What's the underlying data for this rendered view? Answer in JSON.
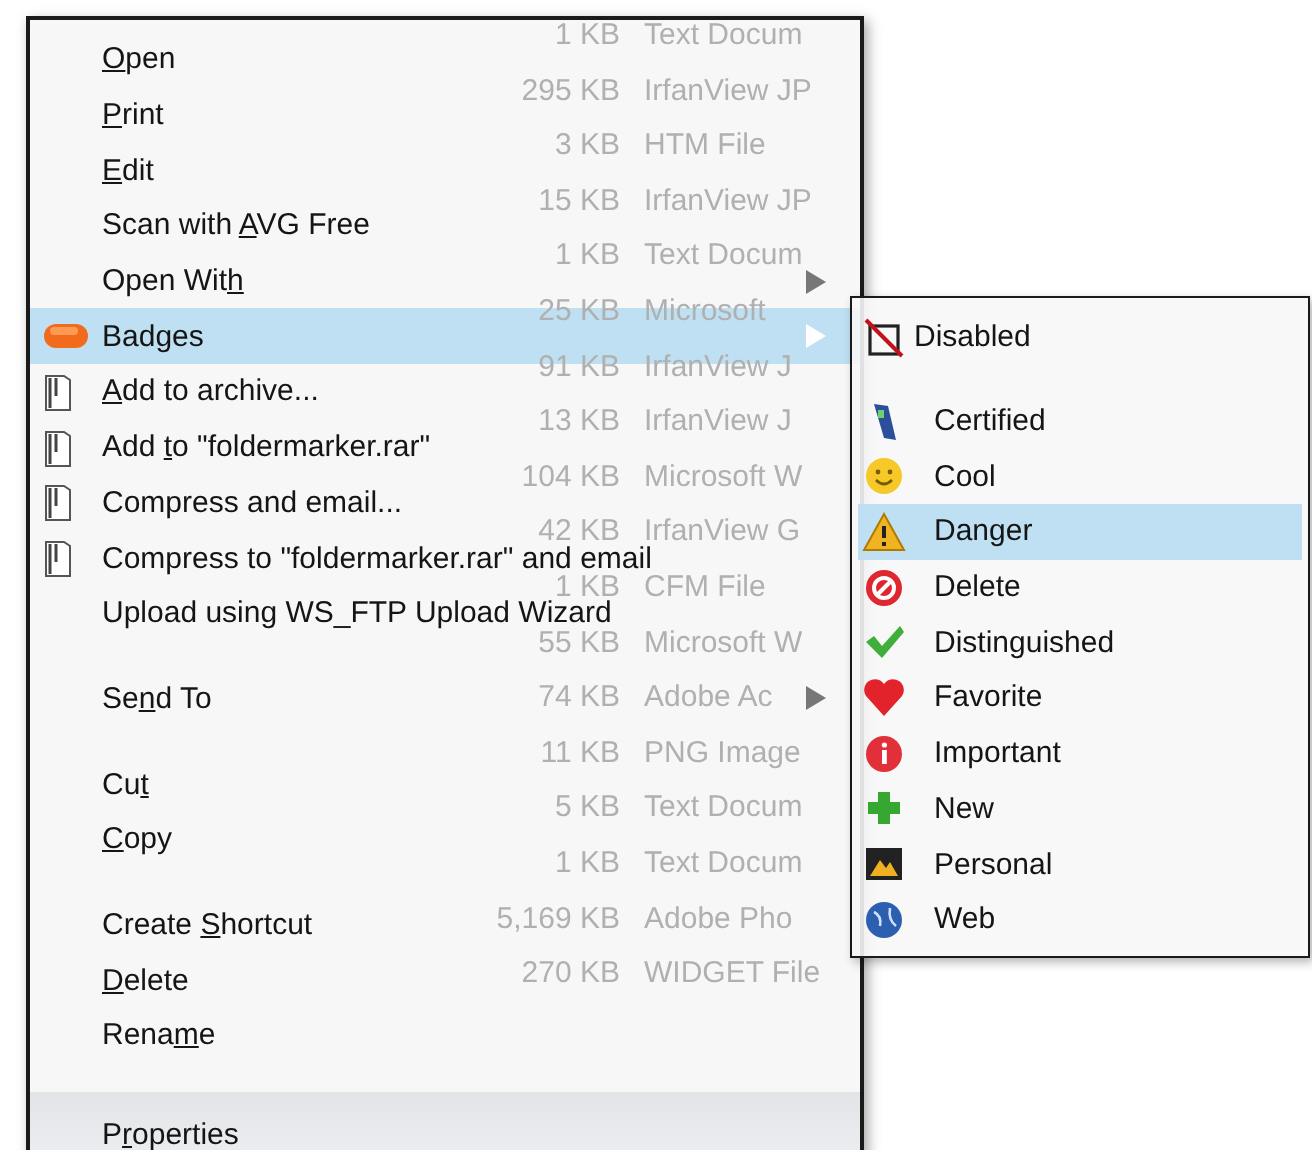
{
  "background_listing": [
    {
      "size": "1 KB",
      "type": "Text Docum"
    },
    {
      "size": "295 KB",
      "type": "IrfanView JP"
    },
    {
      "size": "3 KB",
      "type": "HTM File"
    },
    {
      "size": "15 KB",
      "type": "IrfanView JP"
    },
    {
      "size": "1 KB",
      "type": "Text Docum"
    },
    {
      "size": "25 KB",
      "type": "Microsoft"
    },
    {
      "size": "91 KB",
      "type": "IrfanView J"
    },
    {
      "size": "13 KB",
      "type": "IrfanView J"
    },
    {
      "size": "104 KB",
      "type": "Microsoft W"
    },
    {
      "size": "42 KB",
      "type": "IrfanView G"
    },
    {
      "size": "1 KB",
      "type": "CFM File"
    },
    {
      "size": "55 KB",
      "type": "Microsoft W"
    },
    {
      "size": "74 KB",
      "type": "Adobe Ac"
    },
    {
      "size": "11 KB",
      "type": "PNG Image"
    },
    {
      "size": "5 KB",
      "type": "Text Docum"
    },
    {
      "size": "1 KB",
      "type": "Text Docum"
    },
    {
      "size": "5,169 KB",
      "type": "Adobe Pho"
    },
    {
      "size": "270 KB",
      "type": "WIDGET File"
    }
  ],
  "context_menu": {
    "items": [
      {
        "kind": "item",
        "label": {
          "key": "O",
          "after": "pen"
        }
      },
      {
        "kind": "item",
        "label": {
          "key": "P",
          "after": "rint"
        }
      },
      {
        "kind": "item",
        "label": {
          "key": "E",
          "after": "dit"
        }
      },
      {
        "kind": "item",
        "label": {
          "before": "Scan with ",
          "key": "A",
          "after": "VG Free"
        }
      },
      {
        "kind": "item",
        "label": {
          "before": "Open Wit",
          "key": "h"
        },
        "submenu_arrow": true
      },
      {
        "kind": "badge",
        "label": {
          "before": "Badges"
        },
        "submenu_arrow": true,
        "selected": true
      },
      {
        "kind": "archive",
        "label": {
          "key": "A",
          "after": "dd to archive..."
        }
      },
      {
        "kind": "archive",
        "label": {
          "before": "Add ",
          "key": "t",
          "after": "o \"foldermarker.rar\""
        }
      },
      {
        "kind": "archive",
        "label": {
          "before": "Compress and email..."
        }
      },
      {
        "kind": "archive",
        "label": {
          "before": "Compress to \"foldermarker.rar\" and email"
        }
      },
      {
        "kind": "item",
        "label": {
          "before": "Upload using WS_FTP Upload Wizard"
        }
      },
      {
        "kind": "separator"
      },
      {
        "kind": "item",
        "label": {
          "before": "Se",
          "key": "n",
          "after": "d To"
        },
        "submenu_arrow": true
      },
      {
        "kind": "separator"
      },
      {
        "kind": "item",
        "label": {
          "before": "Cu",
          "key": "t"
        }
      },
      {
        "kind": "item",
        "label": {
          "key": "C",
          "after": "opy"
        }
      },
      {
        "kind": "separator"
      },
      {
        "kind": "item",
        "label": {
          "before": "Create ",
          "key": "S",
          "after": "hortcut"
        }
      },
      {
        "kind": "item",
        "label": {
          "key": "D",
          "after": "elete"
        }
      },
      {
        "kind": "item",
        "label": {
          "before": "Rena",
          "key": "m",
          "after": "e"
        }
      },
      {
        "kind": "footer",
        "label": {
          "before": "P",
          "key": "r",
          "after": "operties"
        }
      }
    ]
  },
  "badges_submenu": {
    "items": [
      {
        "kind": "disabled",
        "label": "Disabled",
        "selected": false
      },
      {
        "kind": "certified",
        "label": "Certified",
        "selected": false
      },
      {
        "kind": "cool",
        "label": "Cool",
        "selected": false
      },
      {
        "kind": "danger",
        "label": "Danger",
        "selected": true
      },
      {
        "kind": "delete",
        "label": "Delete",
        "selected": false
      },
      {
        "kind": "distinguished",
        "label": "Distinguished",
        "selected": false
      },
      {
        "kind": "favorite",
        "label": "Favorite",
        "selected": false
      },
      {
        "kind": "important",
        "label": "Important",
        "selected": false
      },
      {
        "kind": "new",
        "label": "New",
        "selected": false
      },
      {
        "kind": "personal",
        "label": "Personal",
        "selected": false
      },
      {
        "kind": "web",
        "label": "Web",
        "selected": false
      }
    ]
  }
}
